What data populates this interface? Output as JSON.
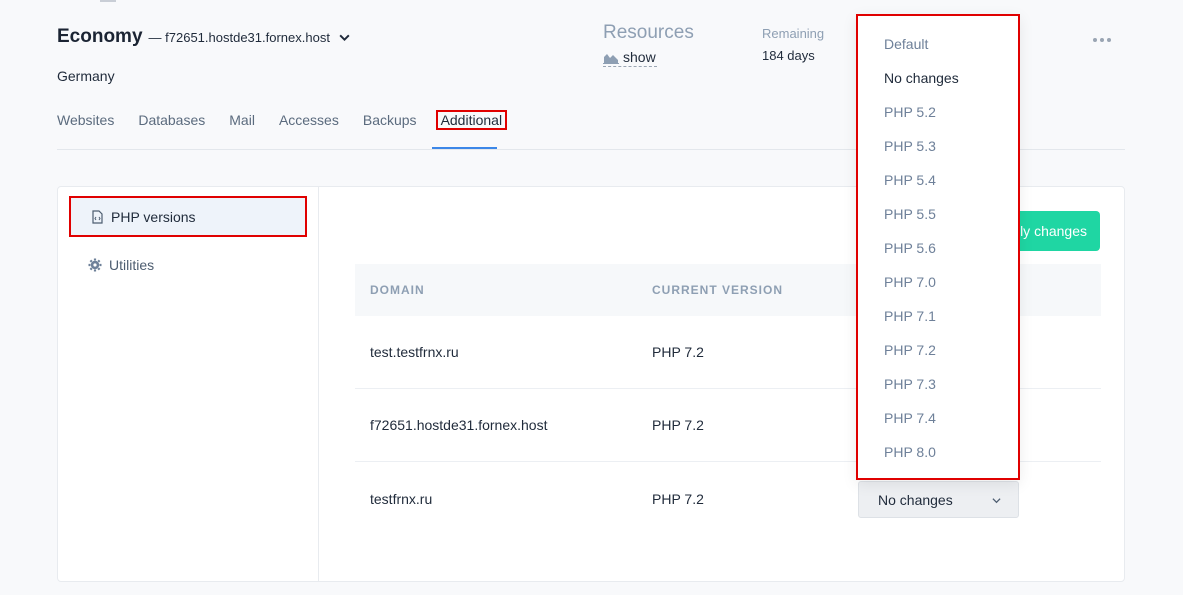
{
  "header": {
    "plan": "Economy",
    "host": "— f72651.hostde31.fornex.host",
    "location": "Germany"
  },
  "resources": {
    "title": "Resources",
    "show_label": "show"
  },
  "remaining": {
    "label": "Remaining",
    "value": "184 days"
  },
  "tabs": [
    {
      "label": "Websites"
    },
    {
      "label": "Databases"
    },
    {
      "label": "Mail"
    },
    {
      "label": "Accesses"
    },
    {
      "label": "Backups"
    },
    {
      "label": "Additional",
      "active": true
    }
  ],
  "sidebar": {
    "items": [
      {
        "label": "PHP versions",
        "icon": "php-file-icon",
        "active": true
      },
      {
        "label": "Utilities",
        "icon": "gear-icon"
      }
    ]
  },
  "apply_button": {
    "label": "Apply changes"
  },
  "table": {
    "columns": [
      "DOMAIN",
      "CURRENT VERSION"
    ],
    "rows": [
      {
        "domain": "test.testfrnx.ru",
        "version": "PHP 7.2"
      },
      {
        "domain": "f72651.hostde31.fornex.host",
        "version": "PHP 7.2"
      },
      {
        "domain": "testfrnx.ru",
        "version": "PHP 7.2"
      }
    ]
  },
  "select": {
    "value": "No changes"
  },
  "dropdown": {
    "options": [
      "Default",
      "No changes",
      "PHP 5.2",
      "PHP 5.3",
      "PHP 5.4",
      "PHP 5.5",
      "PHP 5.6",
      "PHP 7.0",
      "PHP 7.1",
      "PHP 7.2",
      "PHP 7.3",
      "PHP 7.4",
      "PHP 8.0"
    ]
  },
  "colors": {
    "accent_green": "#1fd6a3",
    "tab_underline": "#3c87e8",
    "highlight_red": "#e00000"
  }
}
